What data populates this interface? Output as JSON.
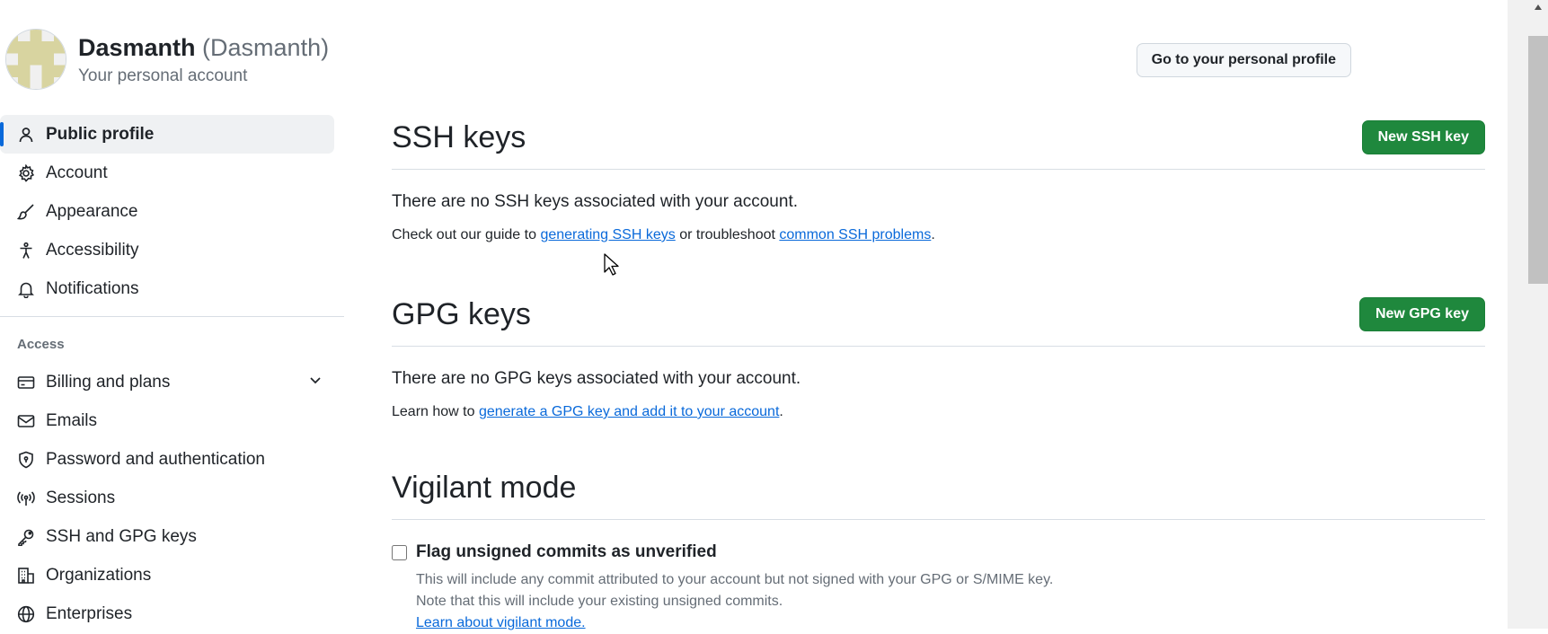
{
  "header": {
    "name": "Dasmanth",
    "handle": "(Dasmanth)",
    "subtitle": "Your personal account",
    "profile_button": "Go to your personal profile"
  },
  "sidebar": {
    "items": [
      {
        "label": "Public profile",
        "icon": "person-icon",
        "active": true
      },
      {
        "label": "Account",
        "icon": "gear-icon"
      },
      {
        "label": "Appearance",
        "icon": "paintbrush-icon"
      },
      {
        "label": "Accessibility",
        "icon": "accessibility-icon"
      },
      {
        "label": "Notifications",
        "icon": "bell-icon"
      }
    ],
    "access_label": "Access",
    "access_items": [
      {
        "label": "Billing and plans",
        "icon": "credit-card-icon"
      },
      {
        "label": "Emails",
        "icon": "mail-icon"
      },
      {
        "label": "Password and authentication",
        "icon": "shield-lock-icon"
      },
      {
        "label": "Sessions",
        "icon": "broadcast-icon"
      },
      {
        "label": "SSH and GPG keys",
        "icon": "key-icon"
      },
      {
        "label": "Organizations",
        "icon": "organization-icon"
      },
      {
        "label": "Enterprises",
        "icon": "globe-icon"
      }
    ]
  },
  "ssh": {
    "title": "SSH keys",
    "new_button": "New SSH key",
    "empty": "There are no SSH keys associated with your account.",
    "help_prefix": "Check out our guide to ",
    "help_link1": "generating SSH keys",
    "help_middle": " or troubleshoot ",
    "help_link2": "common SSH problems",
    "help_suffix": "."
  },
  "gpg": {
    "title": "GPG keys",
    "new_button": "New GPG key",
    "empty": "There are no GPG keys associated with your account.",
    "help_prefix": "Learn how to ",
    "help_link": "generate a GPG key and add it to your account",
    "help_suffix": "."
  },
  "vigilant": {
    "title": "Vigilant mode",
    "checkbox_label": "Flag unsigned commits as unverified",
    "checked": false,
    "note1": "This will include any commit attributed to your account but not signed with your GPG or S/MIME key.",
    "note2": "Note that this will include your existing unsigned commits.",
    "learn_link": "Learn about vigilant mode."
  },
  "colors": {
    "accent_blue": "#0969da",
    "primary_green": "#1f883d",
    "text": "#1f2328",
    "muted": "#656d76"
  }
}
